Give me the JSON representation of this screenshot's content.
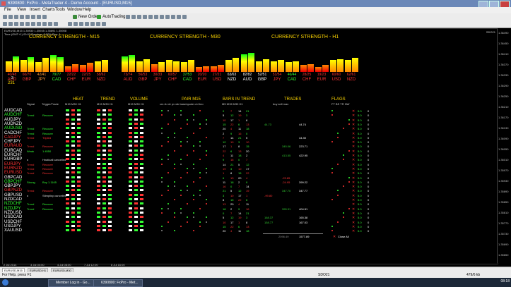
{
  "window": {
    "title": "6390800: FxPro - MetaTrader 4 - Demo Account - [EURUSD,M15]"
  },
  "menu": [
    "File",
    "View",
    "Insert",
    "Charts",
    "Tools",
    "Window",
    "Help"
  ],
  "toolbar": {
    "new_order": "New Order",
    "autotrading": "AutoTrading"
  },
  "chart": {
    "info_line1": "EURUSD,M15 1.35930 1.35935 1.35891 1.35908",
    "info_line2": "Time (GMT+1) 00:03 Random: 0.00% Run: 1",
    "corner": "SDO21",
    "headers": {
      "m15": "CURRENCY STRENGTH - M15",
      "m30": "CURRENCY STRENGTH - M30",
      "h1": "CURRENCY STRENGTH - H1"
    },
    "strength_groups": [
      {
        "id": "m15",
        "items": [
          {
            "score": "40/48",
            "cur": "AUD",
            "color": "#ff3333",
            "heights": [
              0.55,
              0.8
            ]
          },
          {
            "score": "60/70",
            "cur": "GBP",
            "color": "#ff3333",
            "heights": [
              0.6,
              0.75
            ]
          },
          {
            "score": "42/41",
            "cur": "JPY",
            "color": "#ff9a3c",
            "heights": [
              0.5,
              0.7
            ]
          },
          {
            "score": "79/77",
            "cur": "CAD",
            "color": "#33ff33",
            "heights": [
              0.85,
              0.75
            ]
          },
          {
            "score": "22/22",
            "cur": "CHF",
            "color": "#ff3333",
            "heights": [
              0.3,
              0.4
            ]
          },
          {
            "score": "22/25",
            "cur": "EUR",
            "color": "#ff3333",
            "heights": [
              0.35,
              0.45
            ]
          },
          {
            "score": "58/62",
            "cur": "NZD",
            "color": "#ff3333",
            "heights": [
              0.55,
              0.6
            ]
          }
        ]
      },
      {
        "id": "m30",
        "items": [
          {
            "score": "73/74",
            "cur": "AUD",
            "color": "#ff3333",
            "heights": [
              0.8,
              0.85
            ]
          },
          {
            "score": "56/53",
            "cur": "GBP",
            "color": "#ff3333",
            "heights": [
              0.55,
              0.65
            ]
          },
          {
            "score": "30/33",
            "cur": "JPY",
            "color": "#ff3333",
            "heights": [
              0.4,
              0.5
            ]
          },
          {
            "score": "60/57",
            "cur": "CHF",
            "color": "#ff3333",
            "heights": [
              0.6,
              0.55
            ]
          },
          {
            "score": "37/53",
            "cur": "CAD",
            "color": "#33ff33",
            "heights": [
              0.5,
              0.6
            ]
          },
          {
            "score": "20/20",
            "cur": "EUR",
            "color": "#ff3333",
            "heights": [
              0.25,
              0.3
            ]
          },
          {
            "score": "27/21",
            "cur": "USD",
            "color": "#ff3333",
            "heights": [
              0.3,
              0.35
            ]
          },
          {
            "score": "63/63",
            "cur": "NZD",
            "color": "#ffffff",
            "heights": [
              0.6,
              0.7
            ]
          }
        ]
      },
      {
        "id": "h1",
        "items": [
          {
            "score": "82/82",
            "cur": "AUD",
            "color": "#ffffff",
            "heights": [
              0.9,
              0.95
            ]
          },
          {
            "score": "52/51",
            "cur": "GBP",
            "color": "#ffffff",
            "heights": [
              0.55,
              0.65
            ]
          },
          {
            "score": "51/54",
            "cur": "JPY",
            "color": "#ff3333",
            "heights": [
              0.55,
              0.6
            ]
          },
          {
            "score": "46/44",
            "cur": "CAD",
            "color": "#33ff33",
            "heights": [
              0.5,
              0.55
            ]
          },
          {
            "score": "28/25",
            "cur": "CHF",
            "color": "#ff3333",
            "heights": [
              0.35,
              0.4
            ]
          },
          {
            "score": "19/23",
            "cur": "EUR",
            "color": "#ff3333",
            "heights": [
              0.25,
              0.35
            ]
          },
          {
            "score": "60/60",
            "cur": "USD",
            "color": "#ff3333",
            "heights": [
              0.6,
              0.65
            ]
          },
          {
            "score": "62/61",
            "cur": "NZD",
            "color": "#ff3333",
            "heights": [
              0.6,
              0.7
            ]
          }
        ]
      }
    ],
    "extra_numbers": [
      "3",
      "231"
    ],
    "section_headers": {
      "heat": "HEAT",
      "trend": "TREND",
      "volume": "VOLUME",
      "pair": "PAIR M15",
      "bars": "BARS IN TREND",
      "trades": "TRADES",
      "flags": "FLAGS"
    },
    "sub_headers": {
      "signal": "Signal",
      "trigger": "Trigger/Trade",
      "heat_tf": "M15  M30  H1",
      "trend_tf": "M15  M30  H1",
      "volume_tf": "M15  M30  H1",
      "pair_cols": "crs  rk  rdr  pv  wb  base/quote  c/d  bro",
      "bars_cols": "M5  M15  M30  H1",
      "trades_cols": "buy   sell   max",
      "flags_cols": "FT  BE  TR  NW"
    },
    "pairs": [
      {
        "name": "AUDCAD",
        "color": "#ffffff",
        "signal": "",
        "trigger": ""
      },
      {
        "name": "AUDCHF",
        "color": "#33ff33",
        "signal": "Trend",
        "trigger": "Recover"
      },
      {
        "name": "AUDJPY",
        "color": "#ffffff",
        "signal": "",
        "trigger": ""
      },
      {
        "name": "AUDNZD",
        "color": "#ffffff",
        "signal": "",
        "trigger": ""
      },
      {
        "name": "AUDUSD",
        "color": "#33ff33",
        "signal": "Trend",
        "trigger": "Recover"
      },
      {
        "name": "CADCHF",
        "color": "#ffffff",
        "signal": "Trend",
        "trigger": "Recover"
      },
      {
        "name": "CADJPY",
        "color": "#ff3333",
        "signal": "Trend",
        "trigger": "Tripled"
      },
      {
        "name": "CHFJPY",
        "color": "#ffffff",
        "signal": "",
        "trigger": ""
      },
      {
        "name": "EURAUD",
        "color": "#ff3333",
        "signal": "Trend",
        "trigger": "Recover"
      },
      {
        "name": "EURCAD",
        "color": "#ffffff",
        "signal": "Weak",
        "trigger": "1.4550"
      },
      {
        "name": "EURCHF",
        "color": "#ffffff",
        "signal": "",
        "trigger": ""
      },
      {
        "name": "EURGBP",
        "color": "#ffffff",
        "signal": "x",
        "trigger": "Hnaticall cancelled"
      },
      {
        "name": "EURJPY",
        "color": "#ff3333",
        "signal": "Trend",
        "trigger": "Recover"
      },
      {
        "name": "EURNZD",
        "color": "#ff3333",
        "signal": "Trend",
        "trigger": "Recover"
      },
      {
        "name": "EURUSD",
        "color": "#ff3333",
        "signal": "Trend",
        "trigger": "Recover"
      },
      {
        "name": "GBPCAD",
        "color": "#ffffff",
        "signal": "",
        "trigger": ""
      },
      {
        "name": "GBPCHF",
        "color": "#33ff33",
        "signal": "Strong",
        "trigger": "Buy 1.1165"
      },
      {
        "name": "GBPJPY",
        "color": "#ffffff",
        "signal": "",
        "trigger": ""
      },
      {
        "name": "GBPNZD",
        "color": "#ff3333",
        "signal": "Trend",
        "trigger": "Recover"
      },
      {
        "name": "GBPUSD",
        "color": "#ffffff",
        "signal": "x",
        "trigger": "Stimplisy cancelled"
      },
      {
        "name": "NZDCAD",
        "color": "#ffffff",
        "signal": "",
        "trigger": ""
      },
      {
        "name": "NZDCHF",
        "color": "#33ff33",
        "signal": "Trend",
        "trigger": "Recover"
      },
      {
        "name": "NZDJPY",
        "color": "#33ff33",
        "signal": "Trend",
        "trigger": "Recover"
      },
      {
        "name": "NZDUSD",
        "color": "#ffffff",
        "signal": "",
        "trigger": ""
      },
      {
        "name": "USDCAD",
        "color": "#ffffff",
        "signal": "",
        "trigger": ""
      },
      {
        "name": "USDCHF",
        "color": "#ffffff",
        "signal": "",
        "trigger": ""
      },
      {
        "name": "USDJPY",
        "color": "#ffffff",
        "signal": "",
        "trigger": ""
      },
      {
        "name": "XAUUSD",
        "color": "#ffffff",
        "signal": "",
        "trigger": ""
      }
    ],
    "trades": [
      {
        "row": 3,
        "buy": "44.73",
        "sell": "",
        "max": "44.74"
      },
      {
        "row": 6,
        "buy": "",
        "sell": "",
        "max": "44.30"
      },
      {
        "row": 8,
        "buy": "",
        "sell": "345.06",
        "max": "223.71"
      },
      {
        "row": 10,
        "buy": "",
        "sell": "413.55",
        "max": "422.95"
      },
      {
        "row": 15,
        "buy": "",
        "sell": "-23.85",
        "max": ""
      },
      {
        "row": 16,
        "buy": "",
        "sell": "-24.95",
        "max": "399.22"
      },
      {
        "row": 18,
        "buy": "",
        "sell": "347.70",
        "max": "347.77"
      },
      {
        "row": 19,
        "buy": "-99.80",
        "sell": "",
        "max": ""
      },
      {
        "row": 22,
        "buy": "",
        "sell": "395.31",
        "max": "404.51"
      },
      {
        "row": 24,
        "buy": "168.37",
        "sell": "",
        "max": "165.38"
      },
      {
        "row": 25,
        "buy": "158.77",
        "sell": "",
        "max": "167.03"
      }
    ],
    "trades_total": {
      "sell": "2096.49",
      "max": "1577.89"
    },
    "close_all": "Close All",
    "price_scale": [
      "1.36490",
      "1.36450",
      "1.36410",
      "1.36370",
      "1.36330",
      "1.36290",
      "1.36250",
      "1.36210",
      "1.36170",
      "1.36130",
      "1.36090",
      "1.36050",
      "1.36010",
      "1.35970",
      "1.35930",
      "1.35890",
      "1.35850",
      "1.35810",
      "1.35770",
      "1.35730",
      "1.35690",
      "1.35650"
    ],
    "time_axis": [
      "2 Jul 2014",
      "3 Jul 04:00",
      "4 Jul 08:00",
      "7 Jul 12:00",
      "8 Jul 16:00"
    ]
  },
  "tabs": [
    "EURUSD,M15",
    "EURUSD,H1",
    "EURUSD,M30"
  ],
  "status": {
    "help": "For Help, press F1",
    "profile": "SDO21",
    "traffic": "479/6 kb"
  },
  "taskbar": {
    "items": [
      "Member Log in - Go...",
      "6390800: FxPro - Met..."
    ],
    "clock": "08:18"
  }
}
